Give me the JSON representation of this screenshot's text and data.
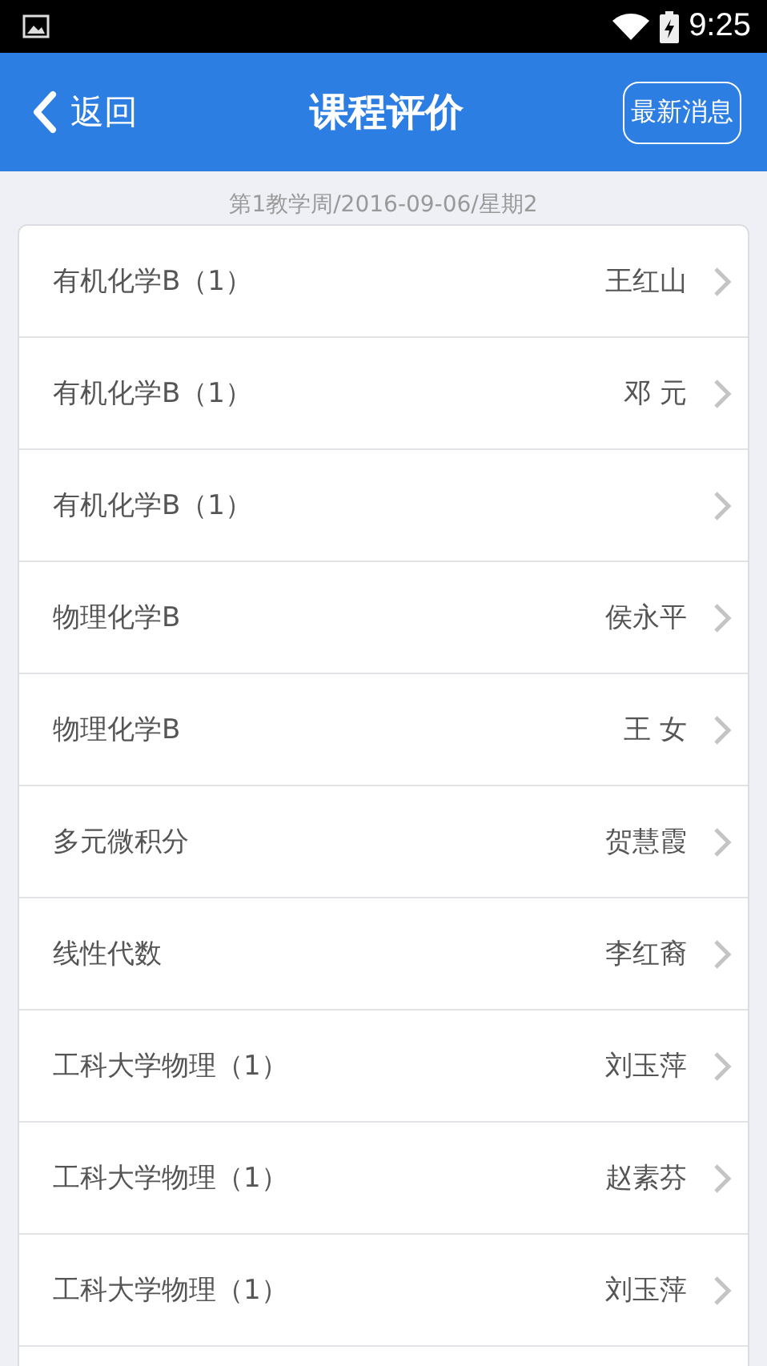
{
  "status_bar": {
    "time": "9:25"
  },
  "header": {
    "back": "返回",
    "title": "课程评价",
    "action": "最新消息"
  },
  "week_line": "第1教学周/2016-09-06/星期2",
  "courses": [
    {
      "name": "有机化学B（1）",
      "teacher": "王红山"
    },
    {
      "name": "有机化学B（1）",
      "teacher": "邓 元"
    },
    {
      "name": "有机化学B（1）"
    },
    {
      "name": "物理化学B",
      "teacher": "侯永平"
    },
    {
      "name": "物理化学B",
      "teacher": "王 女"
    },
    {
      "name": "多元微积分",
      "teacher": "贺慧霞"
    },
    {
      "name": "线性代数",
      "teacher": "李红裔"
    },
    {
      "name": "工科大学物理（1）",
      "teacher": "刘玉萍"
    },
    {
      "name": "工科大学物理（1）",
      "teacher": "赵素芬"
    },
    {
      "name": "工科大学物理（1）",
      "teacher": "刘玉萍"
    }
  ]
}
